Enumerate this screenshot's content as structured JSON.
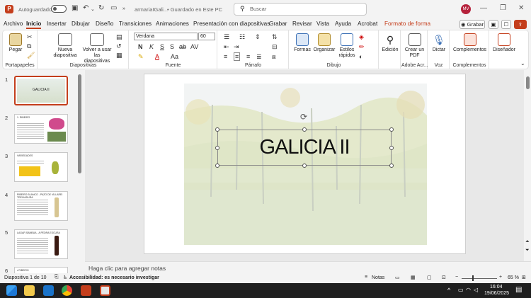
{
  "titlebar": {
    "logo": "P",
    "autosave": "Autoguardado",
    "doc": "armariaIGali...",
    "saved": "• Guardado en Este PC",
    "search_placeholder": "Buscar",
    "avatar": "MV"
  },
  "tabs": [
    "Archivo",
    "Inicio",
    "Insertar",
    "Dibujar",
    "Diseño",
    "Transiciones",
    "Animaciones",
    "Presentación con diapositivas",
    "Grabar",
    "Revisar",
    "Vista",
    "Ayuda",
    "Acrobat",
    "Formato de forma"
  ],
  "ribbon_right": {
    "grabar": "Grabar"
  },
  "ribbon": {
    "portapapeles": {
      "label": "Portapapeles",
      "pegar": "Pegar"
    },
    "diapositivas": {
      "label": "Diapositivas",
      "nueva": "Nueva diapositiva",
      "reusar": "Volver a usar las diapositivas"
    },
    "fuente": {
      "label": "Fuente",
      "font": "Verdana",
      "size": "60",
      "b": "N",
      "i": "K",
      "u": "S",
      "s": "S",
      "ab": "ab",
      "av": "AV",
      "aa": "Aa"
    },
    "parrafo": {
      "label": "Párrafo"
    },
    "dibujo": {
      "label": "Dibujo",
      "formas": "Formas",
      "organizar": "Organizar",
      "estilos": "Estilos rápidos"
    },
    "edicion": {
      "label": "",
      "text": "Edición"
    },
    "adobe": {
      "label": "Adobe Acr...",
      "crear": "Crear un PDF"
    },
    "voz": {
      "label": "Voz",
      "dictar": "Dictar"
    },
    "complementos": {
      "label": "Complementos",
      "text": "Complementos"
    },
    "disenador": {
      "text": "Diseñador"
    }
  },
  "thumbs": [
    {
      "num": "1",
      "title": "GALICIA II"
    },
    {
      "num": "2",
      "title": "1. RIBEIRO"
    },
    {
      "num": "3",
      "title": "VARIEDADES"
    },
    {
      "num": "4",
      "title": "RIBEIRO BLANCO - PAZO DE VILLAREI TREIXADURA"
    },
    {
      "num": "5",
      "title": "LAGAR SAMBUA - A PEDRA ESCURA"
    },
    {
      "num": "6",
      "title": "• RIBEIRO"
    }
  ],
  "slide": {
    "title": "GALICIA II"
  },
  "notes": {
    "placeholder": "Haga clic para agregar notas"
  },
  "status": {
    "slide": "Diapositiva 1 de 10",
    "accessibility": "Accesibilidad: es necesario investigar",
    "notas": "Notas",
    "zoom": "65 %"
  },
  "taskbar": {
    "time": "16:04",
    "date": "19/06/2025"
  },
  "colors": {
    "accent": "#c43e1c",
    "taskbar": "#1f1f1f"
  }
}
